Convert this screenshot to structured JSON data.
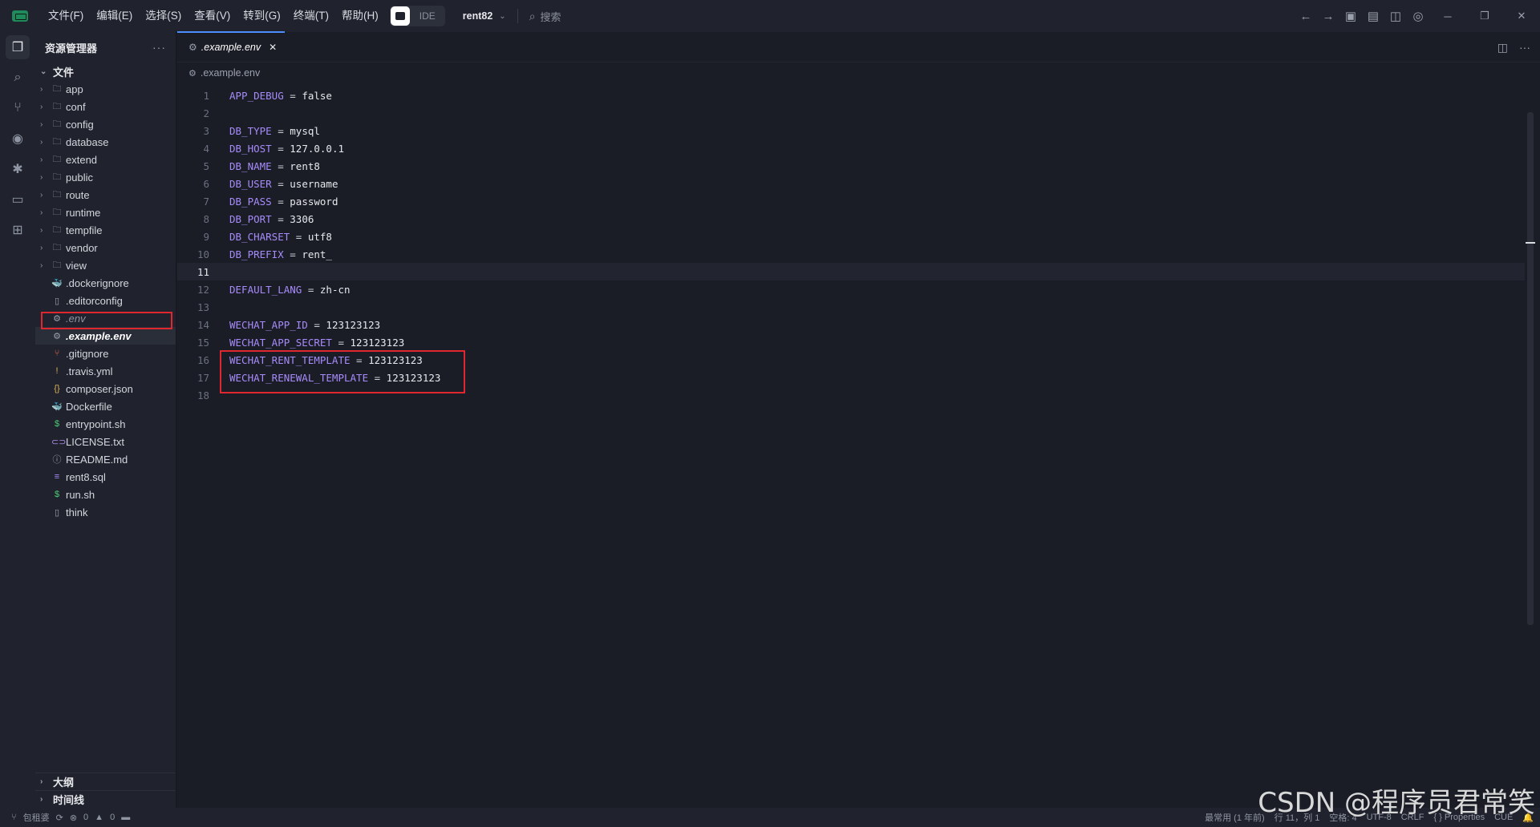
{
  "menu": [
    "文件(F)",
    "编辑(E)",
    "选择(S)",
    "查看(V)",
    "转到(G)",
    "终端(T)",
    "帮助(H)"
  ],
  "ide_label": "IDE",
  "project": "rent82",
  "search_placeholder": "搜索",
  "sidebar": {
    "title": "资源管理器",
    "root": "文件",
    "folders": [
      "app",
      "conf",
      "config",
      "database",
      "extend",
      "public",
      "route",
      "runtime",
      "tempfile",
      "vendor",
      "view"
    ],
    "files": [
      {
        "name": ".dockerignore",
        "icon": "docker-icon",
        "glyph": "🐳"
      },
      {
        "name": ".editorconfig",
        "icon": "file-icon",
        "glyph": "▯"
      },
      {
        "name": ".env",
        "icon": "gear-icon",
        "glyph": "⚙"
      },
      {
        "name": ".example.env",
        "icon": "gear-icon",
        "glyph": "⚙"
      },
      {
        "name": ".gitignore",
        "icon": "git-icon",
        "glyph": "⑂"
      },
      {
        "name": ".travis.yml",
        "icon": "yaml-icon",
        "glyph": "!"
      },
      {
        "name": "composer.json",
        "icon": "json-icon",
        "glyph": "{}"
      },
      {
        "name": "Dockerfile",
        "icon": "docker-icon",
        "glyph": "🐳"
      },
      {
        "name": "entrypoint.sh",
        "icon": "shell-icon",
        "glyph": "$"
      },
      {
        "name": "LICENSE.txt",
        "icon": "license-icon",
        "glyph": "⊂⊃"
      },
      {
        "name": "README.md",
        "icon": "info-icon",
        "glyph": "ⓘ"
      },
      {
        "name": "rent8.sql",
        "icon": "database-icon",
        "glyph": "≡"
      },
      {
        "name": "run.sh",
        "icon": "shell-icon",
        "glyph": "$"
      },
      {
        "name": "think",
        "icon": "file-icon",
        "glyph": "▯"
      }
    ],
    "outline": "大纲",
    "timeline": "时间线"
  },
  "editor": {
    "tab": ".example.env",
    "breadcrumb": ".example.env",
    "current_line": 11,
    "lines": [
      {
        "n": "1",
        "key": "APP_DEBUG",
        "val": "false"
      },
      {
        "n": "2",
        "key": "",
        "val": ""
      },
      {
        "n": "3",
        "key": "DB_TYPE",
        "val": "mysql"
      },
      {
        "n": "4",
        "key": "DB_HOST",
        "val": "127.0.0.1"
      },
      {
        "n": "5",
        "key": "DB_NAME",
        "val": "rent8"
      },
      {
        "n": "6",
        "key": "DB_USER",
        "val": "username"
      },
      {
        "n": "7",
        "key": "DB_PASS",
        "val": "password"
      },
      {
        "n": "8",
        "key": "DB_PORT",
        "val": "3306"
      },
      {
        "n": "9",
        "key": "DB_CHARSET",
        "val": "utf8"
      },
      {
        "n": "10",
        "key": "DB_PREFIX",
        "val": "rent_"
      },
      {
        "n": "11",
        "key": "",
        "val": ""
      },
      {
        "n": "12",
        "key": "DEFAULT_LANG",
        "val": "zh-cn"
      },
      {
        "n": "13",
        "key": "",
        "val": ""
      },
      {
        "n": "14",
        "key": "WECHAT_APP_ID",
        "val": "123123123"
      },
      {
        "n": "15",
        "key": "WECHAT_APP_SECRET",
        "val": "123123123"
      },
      {
        "n": "16",
        "key": "WECHAT_RENT_TEMPLATE",
        "val": "123123123"
      },
      {
        "n": "17",
        "key": "WECHAT_RENEWAL_TEMPLATE",
        "val": "123123123"
      },
      {
        "n": "18",
        "key": "",
        "val": ""
      }
    ]
  },
  "statusbar": {
    "branch": "包租婆",
    "errors": "0",
    "warnings": "0",
    "right": [
      "最常用 (1 年前)",
      "行 11，列 1",
      "空格: 4",
      "UTF-8",
      "CRLF",
      "{ } Properties",
      "CUE"
    ]
  },
  "watermark": "CSDN @程序员君常笑"
}
